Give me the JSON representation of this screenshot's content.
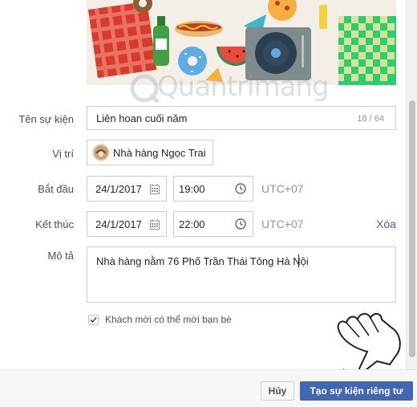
{
  "form": {
    "name": {
      "label": "Tên sự kiện",
      "value": "Liên hoan cuối năm",
      "counter": "18 / 64"
    },
    "location": {
      "label": "Vị trí",
      "value": "Nhà hàng Ngọc Trai"
    },
    "start": {
      "label": "Bắt đầu",
      "date": "24/1/2017",
      "time": "19:00",
      "timezone": "UTC+07"
    },
    "end": {
      "label": "Kết thúc",
      "date": "24/1/2017",
      "time": "22:00",
      "timezone": "UTC+07",
      "remove_link": "Xóa"
    },
    "description": {
      "label": "Mô tả",
      "value": "Nhà hàng nằm 76 Phố Trần Thái Tông Hà Nội"
    },
    "guests_can_invite": {
      "label": "Khách mời có thể mời bạn bè",
      "checked": true
    }
  },
  "watermark": "Quantrimang",
  "footer": {
    "cancel_label": "Hủy",
    "create_label": "Tạo sự kiện riêng tư"
  },
  "colors": {
    "accent": "#4267b2",
    "border": "#ccd0d5",
    "muted": "#90949c"
  },
  "icons": [
    "calendar-icon",
    "clock-icon",
    "check-icon",
    "location-thumbnail",
    "pointer-hand-icon"
  ]
}
